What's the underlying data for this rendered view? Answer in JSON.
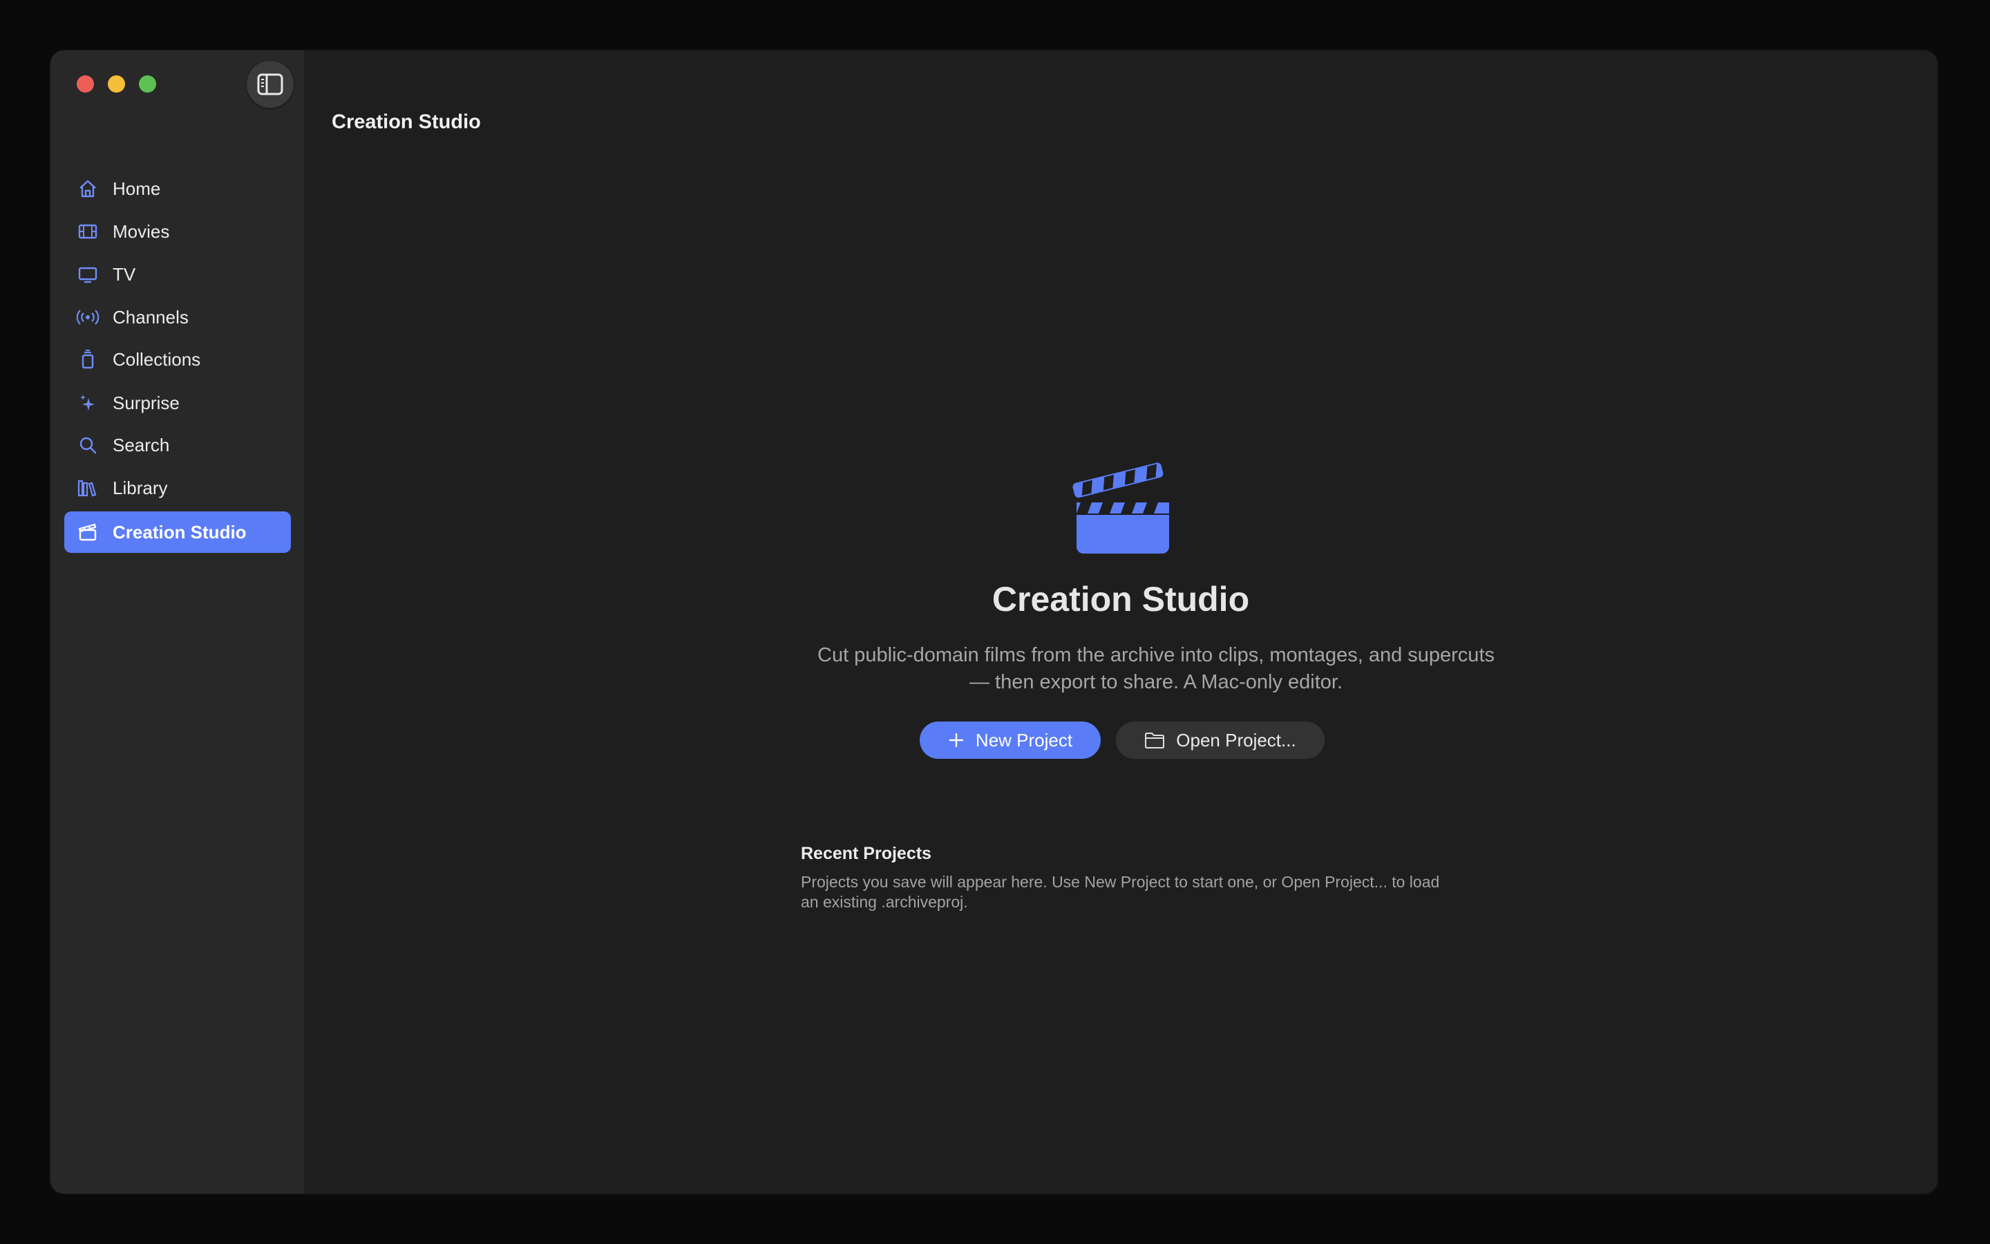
{
  "window": {
    "title": "Creation Studio"
  },
  "sidebar": {
    "items": [
      {
        "label": "Home",
        "icon": "house-icon"
      },
      {
        "label": "Movies",
        "icon": "film-icon"
      },
      {
        "label": "TV",
        "icon": "tv-icon"
      },
      {
        "label": "Channels",
        "icon": "broadcast-icon"
      },
      {
        "label": "Collections",
        "icon": "collection-stack-icon"
      },
      {
        "label": "Surprise",
        "icon": "sparkles-icon"
      },
      {
        "label": "Search",
        "icon": "magnifying-glass-icon"
      },
      {
        "label": "Library",
        "icon": "books-icon"
      },
      {
        "label": "Creation Studio",
        "icon": "clapperboard-icon",
        "active": true
      }
    ]
  },
  "main": {
    "hero_title": "Creation Studio",
    "hero_description": "Cut public-domain films from the archive into clips, montages, and supercuts — then export to share. A Mac-only editor.",
    "new_project_label": "New Project",
    "open_project_label": "Open Project...",
    "recent_title": "Recent Projects",
    "recent_empty_text": "Projects you save will appear here. Use New Project to start one, or Open Project... to load an existing .archiveproj."
  },
  "colors": {
    "accent": "#5a7cf6",
    "sidebar_bg": "#282828",
    "content_bg": "#1e1e1e"
  }
}
